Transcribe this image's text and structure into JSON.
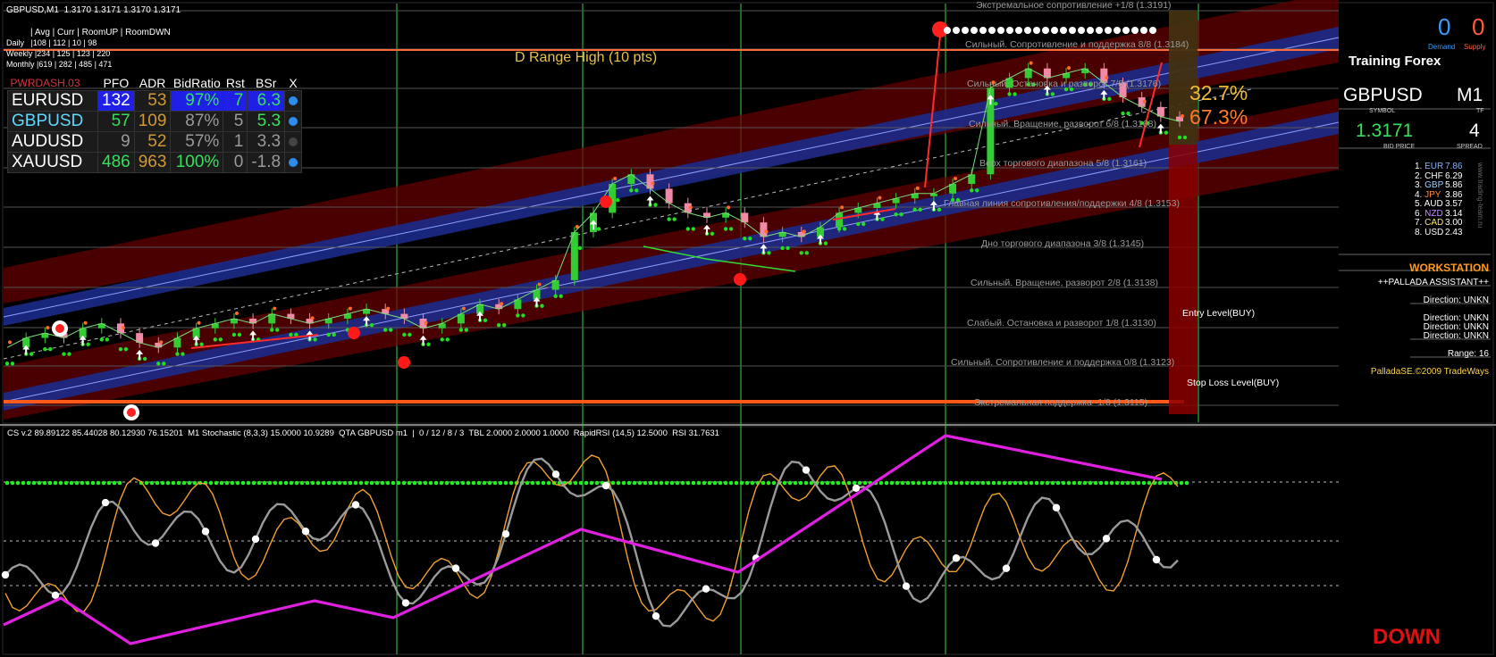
{
  "colors": {
    "background": "#000000",
    "green_line": "#39d93b",
    "orange_line": "#ff6a2a",
    "up_arrow": "#ffffff",
    "bull_candle": "#33cc33",
    "bear_candle": "#f08aa6",
    "channel_fill": "#5a0000",
    "channel_blue": "#1b2a8a",
    "magenta": "#e020e0"
  },
  "header": {
    "title": "GBPUSD,M1  1.3170 1.3171 1.3170 1.3171",
    "menu": "| Avg | Curr | RoomUP | RoomDWN",
    "daily": "Daily   |108 | 112 | 10 | 98",
    "weekly": "Weekly |234 | 125 | 123 | 220",
    "monthly": "Monthly |619 | 282 | 485 | 471"
  },
  "drange_label": "D Range High (10 pts)",
  "dashboard": {
    "brand": "PWRDASH.03",
    "headers": [
      "PFO",
      "ADR",
      "BidRatio",
      "Rst",
      "BSr",
      "X"
    ],
    "rows": [
      {
        "symbol": "EURUSD",
        "pfo": "132",
        "adr": "53",
        "bidratio": "97%",
        "rst": "7",
        "bsr": "6.3",
        "dot": "blue"
      },
      {
        "symbol": "GBPUSD",
        "pfo": "57",
        "adr": "109",
        "bidratio": "87%",
        "rst": "5",
        "bsr": "5.3",
        "dot": "blue"
      },
      {
        "symbol": "AUDUSD",
        "pfo": "9",
        "adr": "52",
        "bidratio": "57%",
        "rst": "1",
        "bsr": "3.3",
        "dot": "gray"
      },
      {
        "symbol": "XAUUSD",
        "pfo": "486",
        "adr": "963",
        "bidratio": "100%",
        "rst": "0",
        "bsr": "-1.8",
        "dot": "blue"
      }
    ]
  },
  "levels": [
    "Экстремальное сопротивление +1/8  (1.3191)",
    "Сильный. Сопротивление и поддержка 8/8  (1.3184)",
    "Сильный. Остановка и разворот 7/8  (1.3176)",
    "Сильный. Вращение, разворот 6/8  (1.3168)",
    "Верх торгового диапазона 5/8  (1.3161)",
    "Главная линия сопротивления/поддержки 4/8  (1.3153)",
    "Дно торгового диапазона 3/8  (1.3145)",
    "Сильный. Вращение, разворот 2/8  (1.3138)",
    "Слабый. Остановка и разворот 1/8  (1.3130)",
    "Сильный. Сопротивление и поддержка 0/8  (1.3123)",
    "Экстремальная поддержка -1/8  (1.3115)"
  ],
  "percent_up": "32.7%",
  "percent_down": "67.3%",
  "entry_label": "Entry Level(BUY)",
  "stoploss_label": "Stop Loss Level(BUY)",
  "side_panel": {
    "count_left": "0",
    "count_right": "0",
    "demand": "Demand",
    "supply": "Supply",
    "title": "Training Forex",
    "symbol": "GBPUSD",
    "symbol_label": "SYMBOL",
    "tf": "M1",
    "tf_label": "TF",
    "bid": "1.3171",
    "bid_label": "BID PRICE",
    "spread": "4",
    "spread_label": "SPREAD",
    "website": "www.trading-team.ru",
    "currencies": [
      {
        "rank": "1.",
        "code": "EUR",
        "value": "7.86",
        "color": "#7fb2ff"
      },
      {
        "rank": "2.",
        "code": "CHF",
        "value": "6.29",
        "color": "#ffffff"
      },
      {
        "rank": "3.",
        "code": "GBP",
        "value": "5.86",
        "color": "#9ad0ff"
      },
      {
        "rank": "4.",
        "code": "JPY",
        "value": "3.86",
        "color": "#ff8c3a"
      },
      {
        "rank": "5.",
        "code": "AUD",
        "value": "3.57",
        "color": "#ffffff"
      },
      {
        "rank": "6.",
        "code": "NZD",
        "value": "3.14",
        "color": "#c58cff"
      },
      {
        "rank": "7.",
        "code": "CAD",
        "value": "3.00",
        "color": "#ffe66a"
      },
      {
        "rank": "8.",
        "code": "USD",
        "value": "2.43",
        "color": "#ffffff"
      }
    ],
    "workstation": "WORKSTATION",
    "assistant": "++PALLADA ASSISTANT++",
    "directions": [
      "Direction: UNKN",
      "Direction: UNKN",
      "Direction: UNKN",
      "Direction: UNKN"
    ],
    "range": "Range: 16",
    "copyright": "PalladaSE.©2009 TradeWays"
  },
  "indicator": {
    "header": "CS v.2 89.89122 85.44028 80.12930 76.15201  M1 Stochastic (8,3,3) 15.0000 10.9289  QTA GBPUSD m1  |  0 / 12 / 8 / 3  TBL 2.0000 2.0000 1.0000  RapidRSI (14,5) 12.5000  RSI 31.7631",
    "signal": "DOWN"
  },
  "chart_data": {
    "type": "line",
    "title": "GBPUSD,M1",
    "ylabel": "",
    "ylim": [
      1.3112,
      1.3194
    ],
    "series": [
      {
        "name": "GBPUSD",
        "values": [
          1.3124,
          1.3126,
          1.3127,
          1.3126,
          1.3128,
          1.3129,
          1.3127,
          1.3125,
          1.3124,
          1.3126,
          1.3128,
          1.3129,
          1.313,
          1.3129,
          1.3131,
          1.313,
          1.3129,
          1.313,
          1.3131,
          1.3132,
          1.3131,
          1.313,
          1.3128,
          1.3129,
          1.3131,
          1.3133,
          1.3132,
          1.3134,
          1.3136,
          1.3138,
          1.3148,
          1.3152,
          1.3158,
          1.316,
          1.3157,
          1.3154,
          1.3152,
          1.3151,
          1.3152,
          1.315,
          1.3147,
          1.3148,
          1.3147,
          1.3149,
          1.3152,
          1.3153,
          1.3154,
          1.3155,
          1.3156,
          1.3156,
          1.3158,
          1.316,
          1.3178,
          1.318,
          1.3182,
          1.318,
          1.3181,
          1.3182,
          1.3179,
          1.3176,
          1.3174,
          1.3172,
          1.3171
        ]
      }
    ]
  }
}
